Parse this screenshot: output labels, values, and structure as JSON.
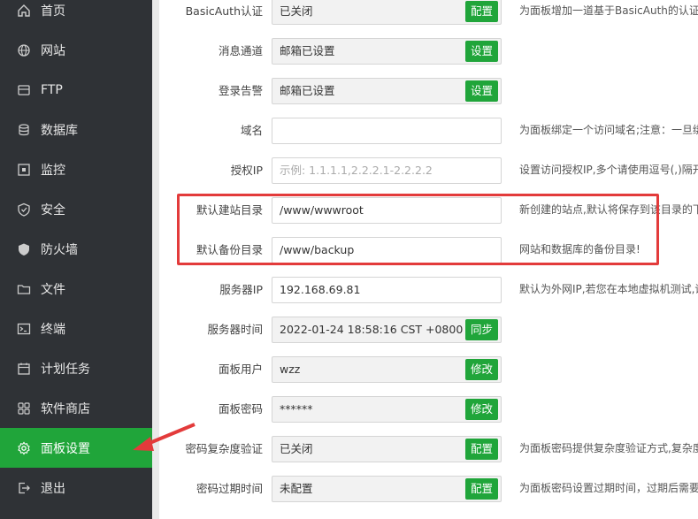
{
  "sidebar": {
    "items": [
      {
        "label": "首页",
        "icon": "home-icon"
      },
      {
        "label": "网站",
        "icon": "globe-icon"
      },
      {
        "label": "FTP",
        "icon": "ftp-icon"
      },
      {
        "label": "数据库",
        "icon": "database-icon"
      },
      {
        "label": "监控",
        "icon": "monitor-icon"
      },
      {
        "label": "安全",
        "icon": "shield-icon"
      },
      {
        "label": "防火墙",
        "icon": "firewall-icon"
      },
      {
        "label": "文件",
        "icon": "folder-icon"
      },
      {
        "label": "终端",
        "icon": "terminal-icon"
      },
      {
        "label": "计划任务",
        "icon": "calendar-icon"
      },
      {
        "label": "软件商店",
        "icon": "apps-icon"
      },
      {
        "label": "面板设置",
        "icon": "gear-icon",
        "active": true
      },
      {
        "label": "退出",
        "icon": "logout-icon"
      }
    ]
  },
  "settings": {
    "rows": [
      {
        "label": "BasicAuth认证",
        "value": "已关闭",
        "readonly": true,
        "button": "配置",
        "hint": "为面板增加一道基于BasicAuth的认证服务"
      },
      {
        "label": "消息通道",
        "value": "邮箱已设置",
        "readonly": true,
        "button": "设置",
        "hint": ""
      },
      {
        "label": "登录告警",
        "value": "邮箱已设置",
        "readonly": true,
        "button": "设置",
        "hint": ""
      },
      {
        "label": "域名",
        "value": "",
        "readonly": false,
        "button": "",
        "hint": "为面板绑定一个访问域名;注意：一旦绑定域名"
      },
      {
        "label": "授权IP",
        "value": "",
        "placeholder": "示例: 1.1.1.1,2.2.2.1-2.2.2.2",
        "readonly": false,
        "button": "",
        "hint": "设置访问授权IP,多个请使用逗号(,)隔开"
      },
      {
        "label": "默认建站目录",
        "value": "/www/wwwroot",
        "readonly": false,
        "button": "",
        "hint": "新创建的站点,默认将保存到该目录的下级目录"
      },
      {
        "label": "默认备份目录",
        "value": "/www/backup",
        "readonly": false,
        "button": "",
        "hint": "网站和数据库的备份目录!"
      },
      {
        "label": "服务器IP",
        "value": "192.168.69.81",
        "readonly": false,
        "button": "",
        "hint": "默认为外网IP,若您在本地虚拟机测试,请"
      },
      {
        "label": "服务器时间",
        "value": "2022-01-24 18:58:16 CST +0800",
        "readonly": true,
        "button": "同步",
        "hint": ""
      },
      {
        "label": "面板用户",
        "value": "wzz",
        "readonly": true,
        "button": "修改",
        "hint": ""
      },
      {
        "label": "面板密码",
        "value": "******",
        "readonly": true,
        "button": "修改",
        "hint": ""
      },
      {
        "label": "密码复杂度验证",
        "value": "已关闭",
        "readonly": true,
        "button": "配置",
        "hint": "为面板密码提供复杂度验证方式,复杂度"
      },
      {
        "label": "密码过期时间",
        "value": "未配置",
        "readonly": true,
        "button": "配置",
        "hint": "为面板密码设置过期时间，过期后需要重新设置"
      }
    ]
  },
  "colors": {
    "accent": "#20a53a",
    "sidebar_bg": "#2f3236",
    "highlight": "#e33b3b"
  }
}
